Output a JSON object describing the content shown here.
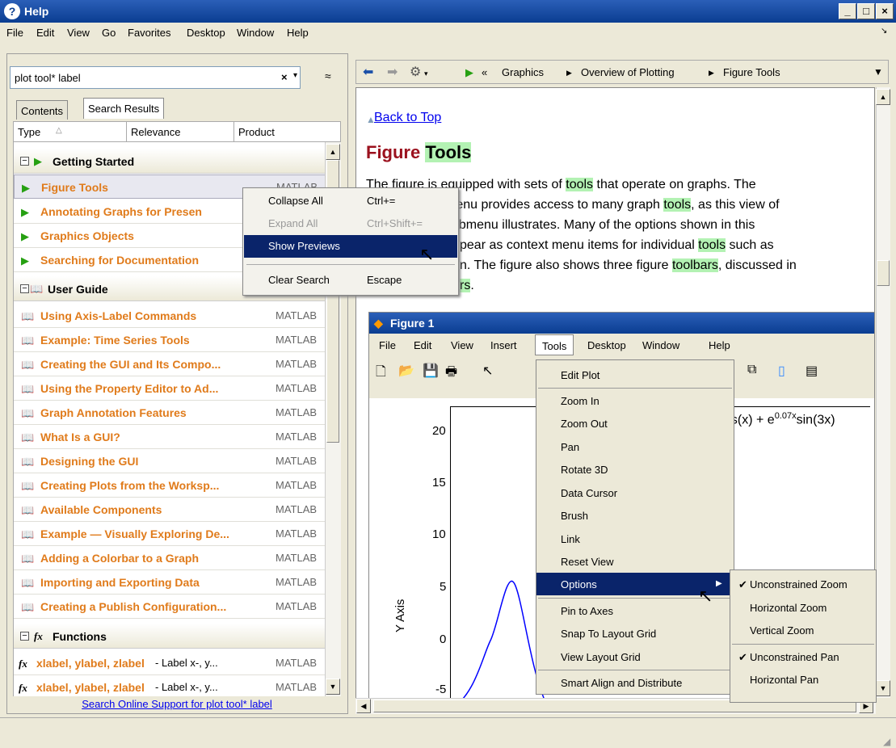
{
  "window": {
    "title": "Help"
  },
  "menubar": [
    "File",
    "Edit",
    "View",
    "Go",
    "Favorites",
    "Desktop",
    "Window",
    "Help"
  ],
  "search": {
    "value": "plot tool* label",
    "clear": "×",
    "options": "▾",
    "collapse": "≈"
  },
  "tabs": [
    "Contents",
    "Search Results"
  ],
  "columns": [
    "Type",
    "Relevance",
    "Product"
  ],
  "groups": [
    {
      "label": "Getting Started"
    },
    {
      "label": "User Guide"
    },
    {
      "label": "Functions"
    }
  ],
  "results": [
    {
      "title": "Figure Tools",
      "product": "MATLAB"
    },
    {
      "title": "Annotating Graphs for Presen",
      "product": ""
    },
    {
      "title": "Graphics Objects",
      "product": ""
    },
    {
      "title": "Searching for Documentation",
      "product": ""
    },
    {
      "title": "Using Axis-Label Commands",
      "product": "MATLAB"
    },
    {
      "title": "Example: Time Series Tools",
      "product": "MATLAB"
    },
    {
      "title": "Creating the GUI and Its Compo...",
      "product": "MATLAB"
    },
    {
      "title": "Using the Property Editor to Ad...",
      "product": "MATLAB"
    },
    {
      "title": "Graph Annotation Features",
      "product": "MATLAB"
    },
    {
      "title": "What Is a GUI?",
      "product": "MATLAB"
    },
    {
      "title": "Designing the GUI",
      "product": "MATLAB"
    },
    {
      "title": "Creating Plots from the Worksp...",
      "product": "MATLAB"
    },
    {
      "title": "Available Components",
      "product": "MATLAB"
    },
    {
      "title": "Example — Visually Exploring De...",
      "product": "MATLAB"
    },
    {
      "title": "Adding a Colorbar to a Graph",
      "product": "MATLAB"
    },
    {
      "title": "Importing and Exporting Data",
      "product": "MATLAB"
    },
    {
      "title": "Creating a Publish Configuration...",
      "product": "MATLAB"
    },
    {
      "title": "xlabel, ylabel, zlabel",
      "desc": " - Label x-, y...",
      "product": "MATLAB"
    },
    {
      "title": "xlabel, ylabel, zlabel",
      "desc": " - Label x-, y...",
      "product": "MATLAB"
    }
  ],
  "online_link": "Search Online Support for plot tool* label",
  "context_menu": [
    {
      "label": "Collapse All",
      "shortcut": "Ctrl+="
    },
    {
      "label": "Expand All",
      "shortcut": "Ctrl+Shift+="
    },
    {
      "label": "Show Previews",
      "shortcut": ""
    },
    {
      "label": "Clear Search",
      "shortcut": "Escape"
    }
  ],
  "breadcrumb": [
    "Graphics",
    "Overview of Plotting",
    "Figure Tools"
  ],
  "doc": {
    "back_to_top": "Back to Top",
    "title_a": "Figure",
    "title_b": "Tools",
    "lines": [
      [
        "The figure is equipped with sets of ",
        "tools",
        " that operate on graphs. The"
      ],
      [
        "menu provides access to many graph ",
        "tools",
        ", as this view of"
      ],
      [
        "submenu illustrates. Many of the options shown in this"
      ],
      [
        "pear as context menu items for individual ",
        "tools",
        " such as"
      ],
      [
        "n. The figure also shows three figure ",
        "toolbars",
        ", discussed in"
      ],
      [
        "rs",
        "."
      ]
    ]
  },
  "figure": {
    "title": "Figure 1",
    "menu": [
      "File",
      "Edit",
      "View",
      "Insert",
      "Tools",
      "Desktop",
      "Window",
      "Help"
    ],
    "expr_a": "cos(x) + e",
    "expr_sup": "0.07x",
    "expr_b": "sin(3x)",
    "ylabel": "Y Axis",
    "yticks": [
      "20",
      "15",
      "10",
      "5",
      "0",
      "-5"
    ]
  },
  "tools_menu": [
    "Edit Plot",
    "Zoom In",
    "Zoom Out",
    "Pan",
    "Rotate 3D",
    "Data Cursor",
    "Brush",
    "Link",
    "Reset View",
    "Options",
    "Pin to Axes",
    "Snap To Layout Grid",
    "View Layout Grid",
    "Smart Align and Distribute"
  ],
  "options_menu": [
    {
      "label": "Unconstrained Zoom",
      "check": "✔"
    },
    {
      "label": "Horizontal Zoom",
      "check": ""
    },
    {
      "label": "Vertical Zoom",
      "check": ""
    },
    {
      "label": "Unconstrained Pan",
      "check": "✔"
    },
    {
      "label": "Horizontal Pan",
      "check": ""
    }
  ]
}
